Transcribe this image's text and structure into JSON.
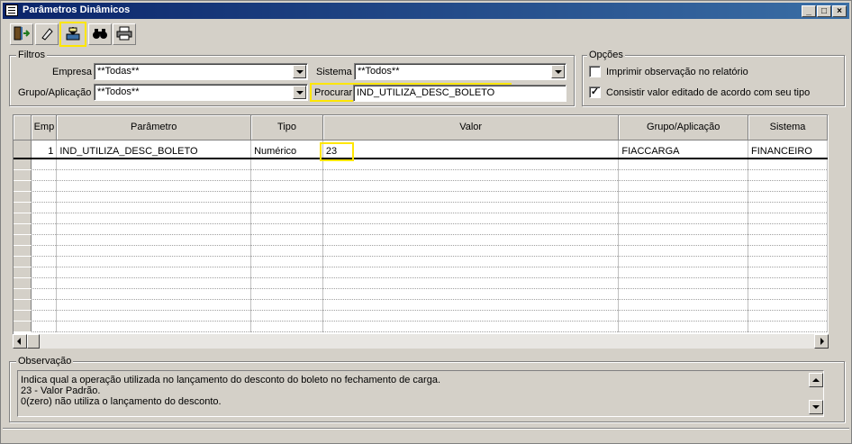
{
  "window": {
    "title": "Parâmetros Dinâmicos",
    "controls": [
      "_",
      "□",
      "×"
    ]
  },
  "toolbar": {
    "buttons": [
      {
        "name": "exit",
        "icon": "exit-door-icon",
        "glyph": "⇦"
      },
      {
        "name": "clear",
        "icon": "eraser-icon",
        "glyph": "✎"
      },
      {
        "name": "load",
        "icon": "load-inbox-icon",
        "glyph": "⇩"
      },
      {
        "name": "find",
        "icon": "binoculars-icon",
        "glyph": "🔭"
      },
      {
        "name": "print",
        "icon": "printer-icon",
        "glyph": "⎙"
      }
    ],
    "highlight_color": "#ffe600"
  },
  "filtros": {
    "title": "Filtros",
    "empresa_label": "Empresa",
    "empresa_value": "**Todas**",
    "grupo_label": "Grupo/Aplicação",
    "grupo_value": "**Todos**",
    "sistema_label": "Sistema",
    "sistema_value": "**Todos**",
    "procurar_label": "Procurar",
    "procurar_value": "IND_UTILIZA_DESC_BOLETO"
  },
  "opcoes": {
    "title": "Opções",
    "imprimir_label": "Imprimir observação no relatório",
    "imprimir_checked": false,
    "consistir_label": "Consistir valor editado de acordo com seu tipo",
    "consistir_checked": true
  },
  "grid": {
    "columns": [
      "Emp",
      "Parâmetro",
      "Tipo",
      "Valor",
      "Grupo/Aplicação",
      "Sistema"
    ],
    "rows": [
      {
        "emp": "1",
        "parametro": "IND_UTILIZA_DESC_BOLETO",
        "tipo": "Numérico",
        "valor": "23",
        "grupo": "FIACCARGA",
        "sistema": "FINANCEIRO"
      }
    ]
  },
  "observacao": {
    "title": "Observação",
    "lines": [
      "Indica qual a operação utilizada no lançamento do desconto do boleto no fechamento de carga.",
      "23 - Valor Padrão.",
      "0(zero) não utiliza o lançamento do desconto."
    ]
  }
}
